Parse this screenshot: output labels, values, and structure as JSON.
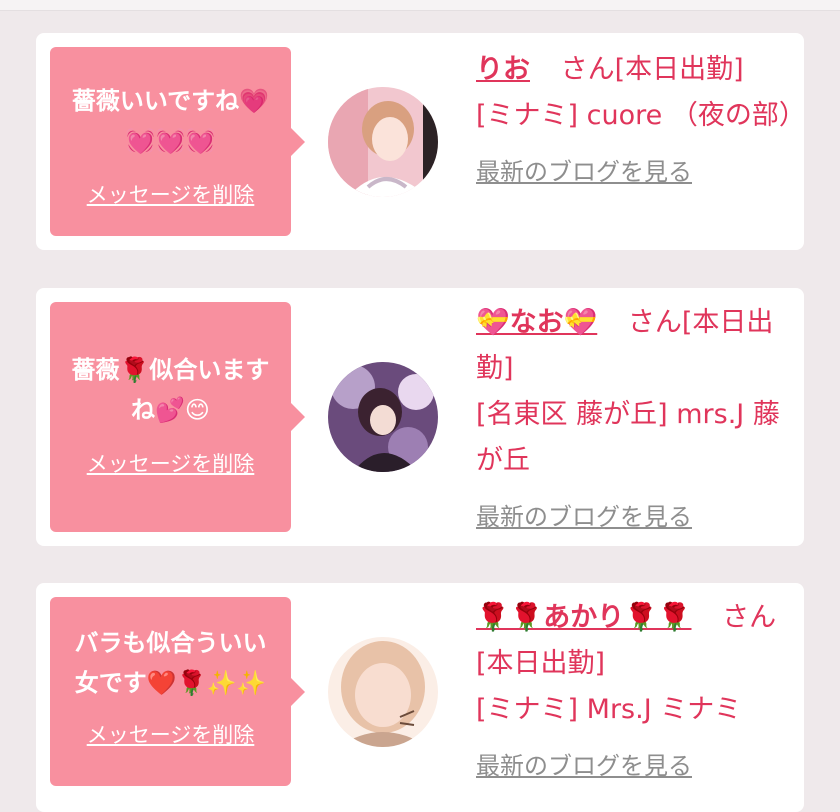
{
  "cards": [
    {
      "message": "薔薇いいですね💗\n💓💓💓",
      "delete_label": "メッセージを削除",
      "name": "りお",
      "suffix": "さん[本日出勤]",
      "shop": "[ミナミ] cuore （夜の部）",
      "blog_label": "最新のブログを見る",
      "avatar_colors": [
        "#f2c7cf",
        "#d28d97",
        "#ffffff",
        "#8a5b5b"
      ]
    },
    {
      "message": "薔薇🌹似合います\nね💕😊",
      "delete_label": "メッセージを削除",
      "name": "💝なお💝",
      "suffix": "さん[本日出勤]",
      "shop": "[名東区 藤が丘] mrs.J 藤が丘",
      "blog_label": "最新のブログを見る",
      "avatar_colors": [
        "#6a4b7c",
        "#b7a0c9",
        "#3b2230",
        "#e9d8ef"
      ]
    },
    {
      "message": "バラも似合ういい\n女です❤️🌹✨✨",
      "delete_label": "メッセージを削除",
      "name": "🌹🌹あかり🌹🌹",
      "suffix": "さん[本日出勤]",
      "shop": "[ミナミ] Mrs.J ミナミ",
      "blog_label": "最新のブログを見る",
      "avatar_colors": [
        "#f4d2c3",
        "#caa58f",
        "#fbeee6",
        "#6b4b3a"
      ]
    }
  ],
  "colors": {
    "accent": "#e0355b",
    "bubble": "#f8909f",
    "link_gray": "#8e8e8e",
    "background": "#efe9eb"
  }
}
